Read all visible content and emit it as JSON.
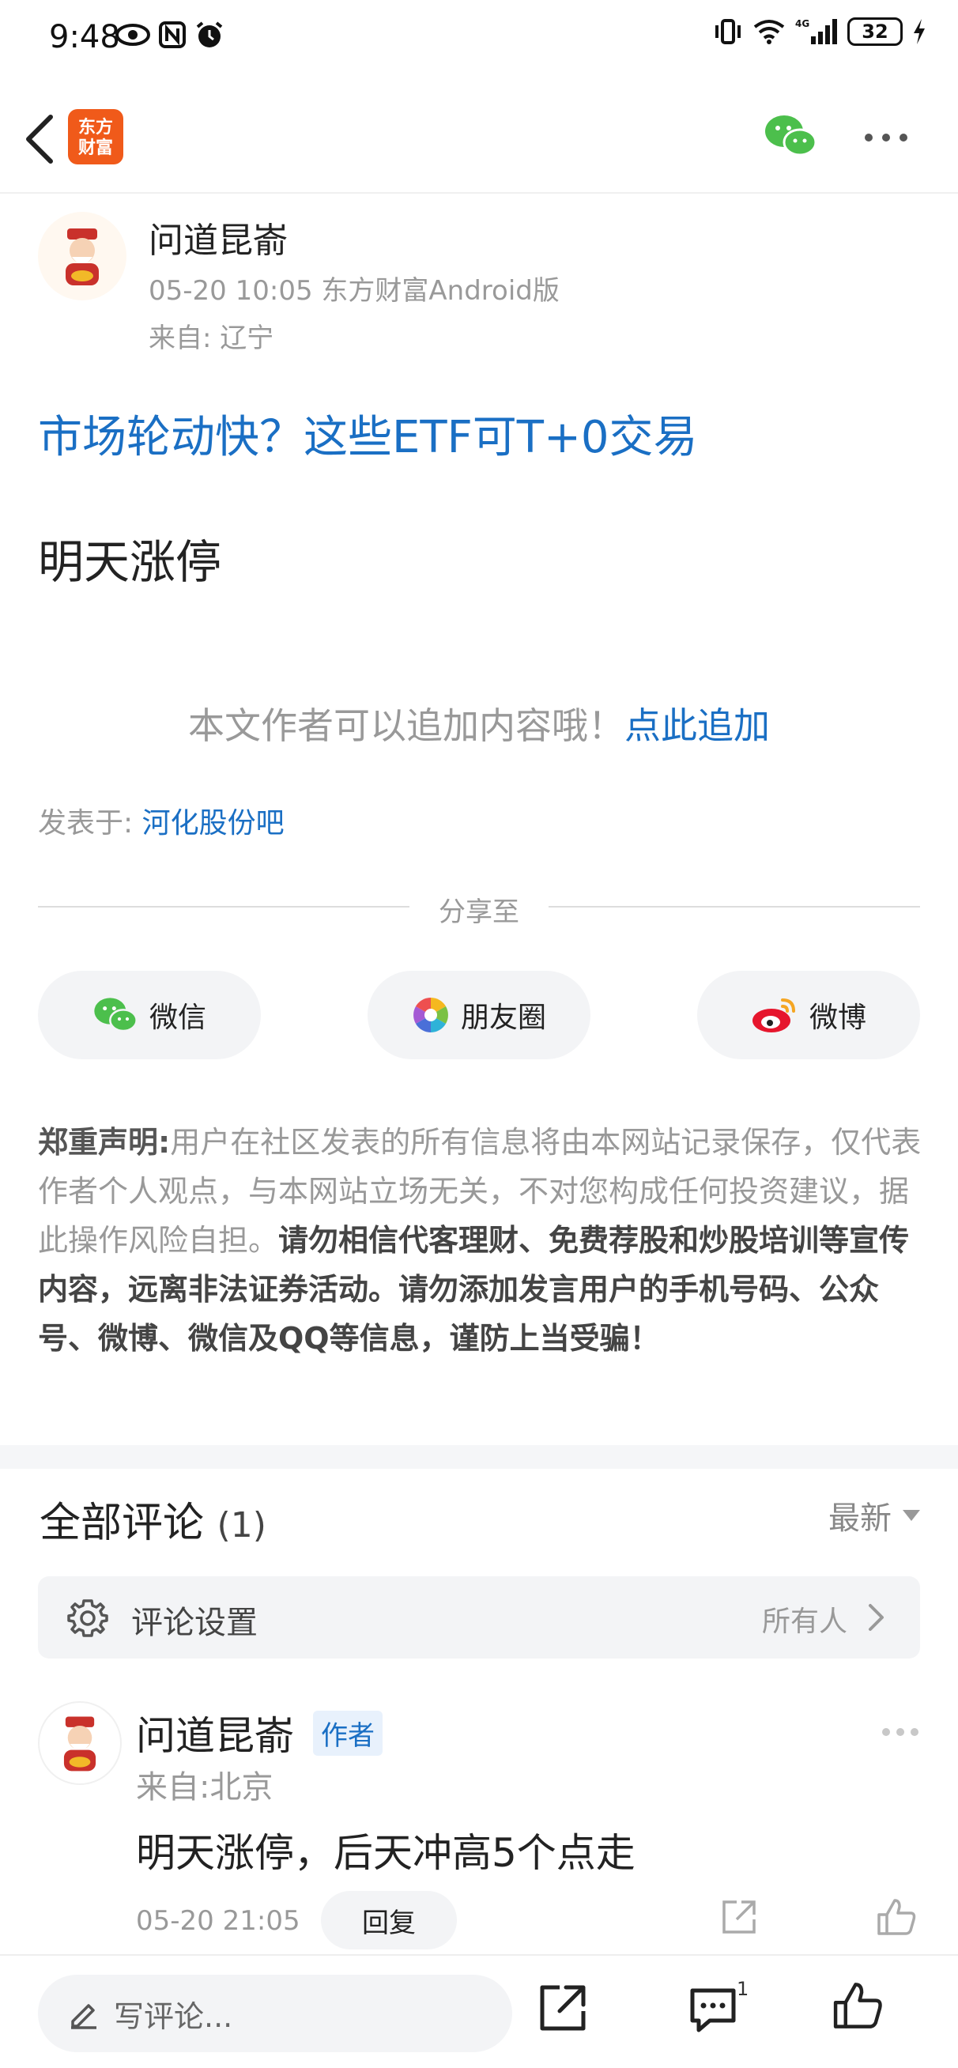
{
  "status_bar": {
    "time": "9:48",
    "battery": "32",
    "network": "4G"
  },
  "header": {
    "logo_text": "东方\n财富",
    "icons": [
      "back-icon",
      "wechat-icon",
      "more-icon"
    ]
  },
  "author": {
    "name": "问道昆嵛",
    "meta": "05-20 10:05 东方财富Android版",
    "location": "来自: 辽宁"
  },
  "promo_link": "市场轮动快？这些ETF可T+0交易",
  "post_body": "明天涨停",
  "append_tip": {
    "text": "本文作者可以追加内容哦！",
    "link": "点此追加"
  },
  "posted_in": {
    "label": "发表于: ",
    "forum": "河化股份吧"
  },
  "share": {
    "label": "分享至",
    "buttons": [
      {
        "label": "微信",
        "icon": "wechat-icon"
      },
      {
        "label": "朋友圈",
        "icon": "moments-icon"
      },
      {
        "label": "微博",
        "icon": "weibo-icon"
      }
    ]
  },
  "disclaimer": {
    "head": "郑重声明:",
    "normal": "用户在社区发表的所有信息将由本网站记录保存，仅代表作者个人观点，与本网站立场无关，不对您构成任何投资建议，据此操作风险自担。",
    "strong": "请勿相信代客理财、免费荐股和炒股培训等宣传内容，远离非法证券活动。请勿添加发言用户的手机号码、公众号、微博、微信及QQ等信息，谨防上当受骗！"
  },
  "comments": {
    "title": "全部评论",
    "count": "(1)",
    "sort": "最新",
    "settings_label": "评论设置",
    "settings_value": "所有人",
    "items": [
      {
        "name": "问道昆嵛",
        "badge": "作者",
        "location": "来自:北京",
        "text": "明天涨停，后天冲高5个点走",
        "time": "05-20 21:05",
        "reply": "回复"
      }
    ]
  },
  "bottom_bar": {
    "placeholder": "写评论...",
    "comment_count": "1"
  },
  "colors": {
    "link": "#1a6fc4",
    "brand": "#f05a1a",
    "wechat": "#4cbf4c"
  }
}
